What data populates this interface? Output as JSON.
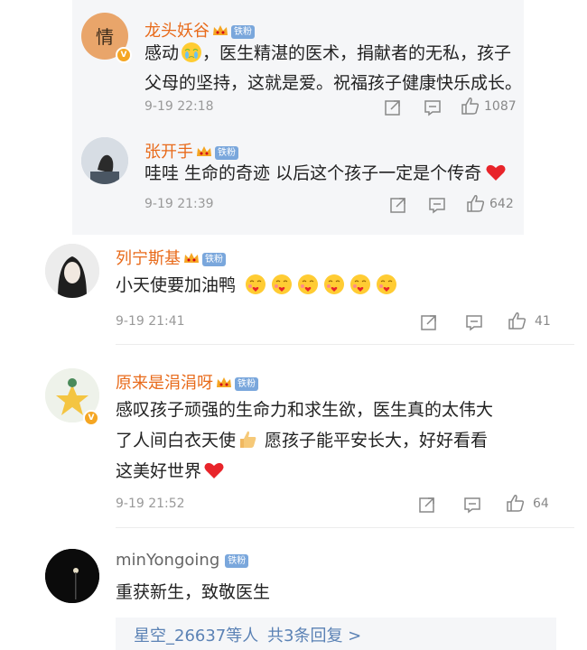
{
  "comments": [
    {
      "name": "龙头妖谷",
      "name_color": "#e86a1a",
      "fan_badge": "铁粉",
      "lines": [
        "感动",
        "，医生精湛的医术，捐献者的无私，孩子",
        "父母的坚持，这就是爱。祝福孩子健康快乐成长。"
      ],
      "time": "9-19 22:18",
      "likes": "1087"
    },
    {
      "name": "张开手",
      "name_color": "#e86a1a",
      "fan_badge": "铁粉",
      "lines": [
        "哇哇 生命的奇迹 以后这个孩子一定是个传奇"
      ],
      "time": "9-19 21:39",
      "likes": "642"
    },
    {
      "name": "列宁斯基",
      "name_color": "#e86a1a",
      "fan_badge": "铁粉",
      "lines": [
        "小天使要加油鸭"
      ],
      "time": "9-19 21:41",
      "likes": "41"
    },
    {
      "name": "原来是涓涓呀",
      "name_color": "#e86a1a",
      "fan_badge": "铁粉",
      "lines": [
        "感叹孩子顽强的生命力和求生欲，医生真的太伟大",
        "了人间白衣天使",
        " 愿孩子能平安长大，好好看看",
        "这美好世界"
      ],
      "time": "9-19 21:52",
      "likes": "64"
    },
    {
      "name": "minYongoing",
      "name_color": "#666666",
      "fan_badge": "铁粉",
      "lines": [
        "重获新生，致敬医生"
      ],
      "reply_users": "星空_26637等人",
      "reply_count": "共3条回复 >"
    }
  ],
  "icons": {
    "share": "share-icon",
    "comment": "comment-icon",
    "like": "thumbs-up-icon",
    "crown": "crown-icon",
    "verified": "verified-v-icon"
  },
  "colors": {
    "orange_name": "#e86a1a",
    "fan_badge": "#7aa7dc",
    "link_blue": "#5b82b5"
  }
}
